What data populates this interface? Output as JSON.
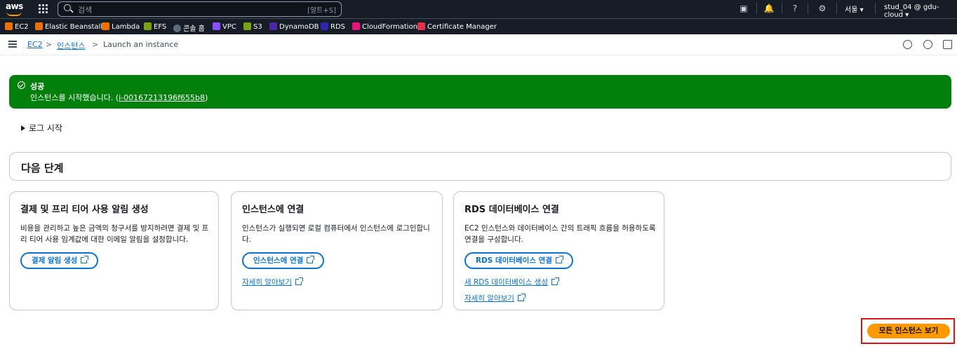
{
  "topnav": {
    "logo": "aws",
    "search_placeholder": "검색",
    "search_shortcut": "[알트+S]",
    "region": "서울 ▾",
    "user": "stud_04 @ gdu-cloud ▾"
  },
  "favorites": [
    {
      "label": "EC2",
      "color": "#ed7100"
    },
    {
      "label": "Elastic Beanstalk",
      "color": "#ed7100"
    },
    {
      "label": "Lambda",
      "color": "#ed7100"
    },
    {
      "label": "EFS",
      "color": "#7aa116"
    },
    {
      "label": "콘솔 홈",
      "color": "#5f6b7a"
    },
    {
      "label": "VPC",
      "color": "#8c4fff"
    },
    {
      "label": "S3",
      "color": "#7aa116"
    },
    {
      "label": "DynamoDB",
      "color": "#4d27aa"
    },
    {
      "label": "RDS",
      "color": "#2e27ad"
    },
    {
      "label": "CloudFormation",
      "color": "#e7157b"
    },
    {
      "label": "Certificate Manager",
      "color": "#dd344c"
    }
  ],
  "breadcrumb": {
    "ec2": "EC2",
    "instances": "인스턴스",
    "current": "Launch an instance",
    "sep": ">"
  },
  "flash": {
    "title": "성공",
    "message": "인스턴스를 시작했습니다. (",
    "instance_id": "i-00167213196f655b8",
    "message_end": ")"
  },
  "logs": {
    "label": "로그 시작"
  },
  "next_steps": {
    "heading": "다음 단계"
  },
  "cards": [
    {
      "title": "결제 및 프리 티어 사용 알림 생성",
      "desc": "비용을 관리하고 높은 금액의 청구서를 방지하려면 결제 및 프리 티어 사용 임계값에 대한 이메일 알림을 설정합니다.",
      "button": "결제 알림 생성"
    },
    {
      "title": "인스턴스에 연결",
      "desc": "인스턴스가 실행되면 로컬 컴퓨터에서 인스턴스에 로그인합니다.",
      "button": "인스턴스에 연결",
      "link1": "자세히 알아보기"
    },
    {
      "title": "RDS 데이터베이스 연결",
      "desc": "EC2 인스턴스와 데이터베이스 간의 트래픽 흐름을 허용하도록 연결을 구성합니다.",
      "button": "RDS 데이터베이스 연결",
      "link1": "새 RDS 데이터베이스 생성",
      "link2": "자세히 알아보기"
    }
  ],
  "primary_button": "모든 인스턴스 보기",
  "colors": {
    "nav": "#161d26",
    "success": "#037f0c",
    "link": "#0972d3",
    "primary": "#ff9900",
    "highlight": "#d91515"
  }
}
